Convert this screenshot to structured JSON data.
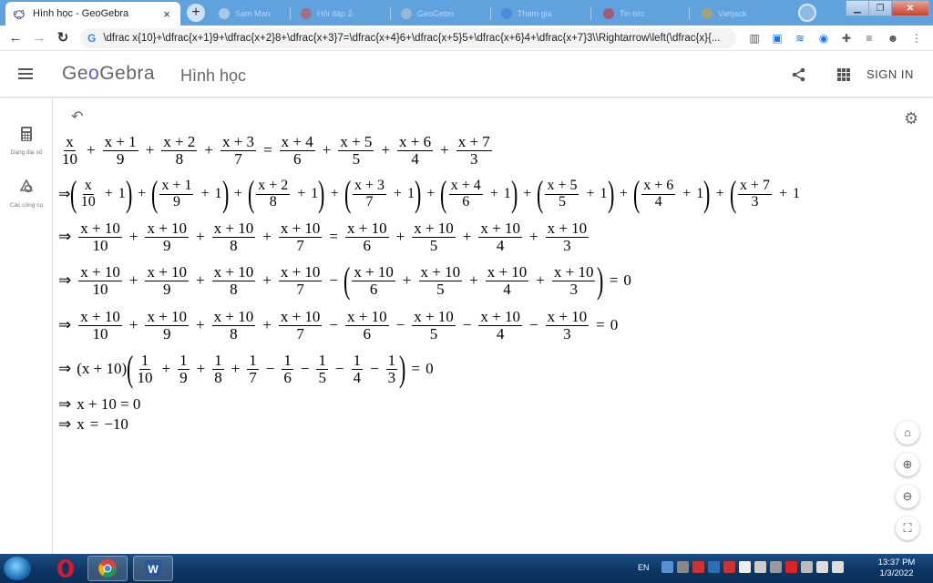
{
  "browser": {
    "active_tab_title": "Hình học - GeoGebra",
    "tab_close": "×",
    "new_tab": "+",
    "background_tabs": [
      "Sam Man",
      "Hỏi đáp 247",
      "GeoGebra",
      "Tham gia",
      "Tin tức",
      "Vietjack"
    ],
    "url": "\\dfrac x{10}+\\dfrac{x+1}9+\\dfrac{x+2}8+\\dfrac{x+3}7=\\dfrac{x+4}6+\\dfrac{x+5}5+\\dfrac{x+6}4+\\dfrac{x+7}3\\\\Rightarrow\\left(\\dfrac{x}{...",
    "omnibox_icon": "G",
    "back": "←",
    "forward": "→",
    "reload": "↻"
  },
  "header": {
    "logo_pre": "Ge",
    "logo_o": "o",
    "logo_post": "Gebra",
    "app_name": "Hình học",
    "sign_in": "SIGN IN"
  },
  "sidebar": {
    "items": [
      {
        "label": "Dạng đại số",
        "icon": "calculator-icon"
      },
      {
        "label": "Các công cụ",
        "icon": "shapes-tools-icon"
      }
    ]
  },
  "math": {
    "implies": "⇒",
    "plus": "+",
    "minus": "−",
    "eq": "=",
    "zero": "0",
    "one": "1",
    "x": "x",
    "x_plus_10": "x + 10",
    "row1": {
      "lhs": [
        [
          "x",
          "10"
        ],
        [
          "x + 1",
          "9"
        ],
        [
          "x + 2",
          "8"
        ],
        [
          "x + 3",
          "7"
        ]
      ],
      "rhs": [
        [
          "x + 4",
          "6"
        ],
        [
          "x + 5",
          "5"
        ],
        [
          "x + 6",
          "4"
        ],
        [
          "x + 7",
          "3"
        ]
      ]
    },
    "row3": {
      "lhs_dens": [
        "10",
        "9",
        "8",
        "7"
      ],
      "rhs_dens": [
        "6",
        "5",
        "4",
        "3"
      ]
    },
    "row6_fracs": [
      [
        "1",
        "10"
      ],
      [
        "1",
        "9"
      ],
      [
        "1",
        "8"
      ],
      [
        "1",
        "7"
      ],
      [
        "1",
        "6"
      ],
      [
        "1",
        "5"
      ],
      [
        "1",
        "4"
      ],
      [
        "1",
        "3"
      ]
    ],
    "row7": "x + 10 = 0",
    "row8_lhs": "x",
    "row8_rhs": "−10"
  },
  "taskbar": {
    "lang": "EN",
    "time": "13:37 PM",
    "date": "1/3/2022"
  },
  "colors": {
    "tabstrip": "#5fa2dd",
    "geogebra_accent": "#6557d2",
    "taskbar": "#0d3663"
  }
}
